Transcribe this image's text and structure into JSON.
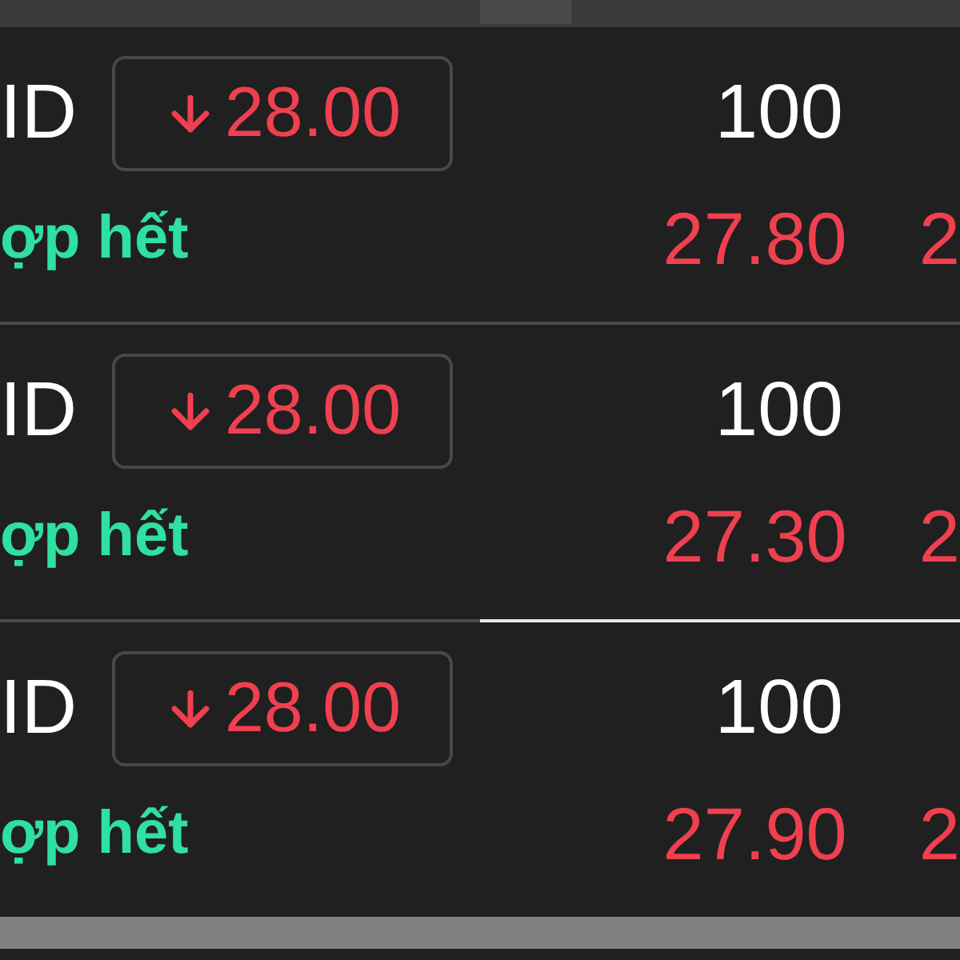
{
  "rows": [
    {
      "symbol": "ID",
      "price": "28.00",
      "kind": "down",
      "quantity": "100",
      "status": "ợp hết",
      "match_price": "27.80",
      "column_5": "2",
      "selected": false
    },
    {
      "symbol": "ID",
      "price": "28.00",
      "kind": "down",
      "quantity": "100",
      "status": "ợp hết",
      "match_price": "27.30",
      "column_5": "2",
      "selected": false
    },
    {
      "symbol": "ID",
      "price": "28.00",
      "kind": "down",
      "quantity": "100",
      "status": "ợp hết",
      "match_price": "27.90",
      "column_5": "2",
      "selected": true
    }
  ]
}
